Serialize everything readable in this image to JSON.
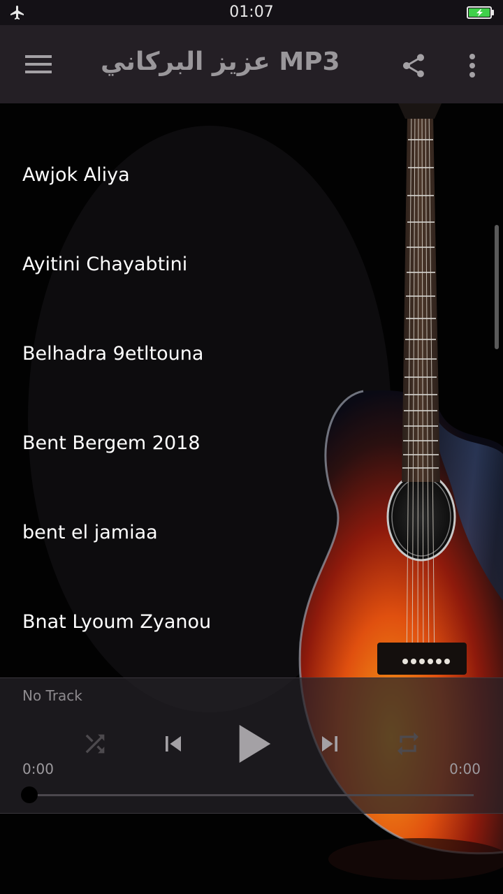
{
  "status_bar": {
    "time": "01:07",
    "airplane_icon": "airplane-icon",
    "battery_icon": "battery-charging-icon",
    "battery_color": "#3fd14a"
  },
  "app_bar": {
    "title": "عزيز البركاني MP3",
    "menu_icon": "hamburger-menu-icon",
    "share_icon": "share-icon",
    "more_icon": "more-vert-icon"
  },
  "songs": [
    {
      "title": "Awjok Aliya"
    },
    {
      "title": "Ayitini Chayabtini"
    },
    {
      "title": "Belhadra 9etltouna"
    },
    {
      "title": "Bent Bergem 2018"
    },
    {
      "title": "bent el jamiaa"
    },
    {
      "title": "Bnat Lyoum Zyanou"
    }
  ],
  "player": {
    "track": "No Track",
    "current_time": "0:00",
    "total_time": "0:00",
    "progress": 0,
    "controls": {
      "shuffle": "shuffle-icon",
      "previous": "skip-previous-icon",
      "play": "play-icon",
      "next": "skip-next-icon",
      "repeat": "repeat-icon"
    }
  },
  "colors": {
    "app_bar": "#241f25",
    "status_bar": "#141116",
    "title_text": "#9a979b",
    "list_text": "#ffffff",
    "player_bg": "#262228"
  }
}
